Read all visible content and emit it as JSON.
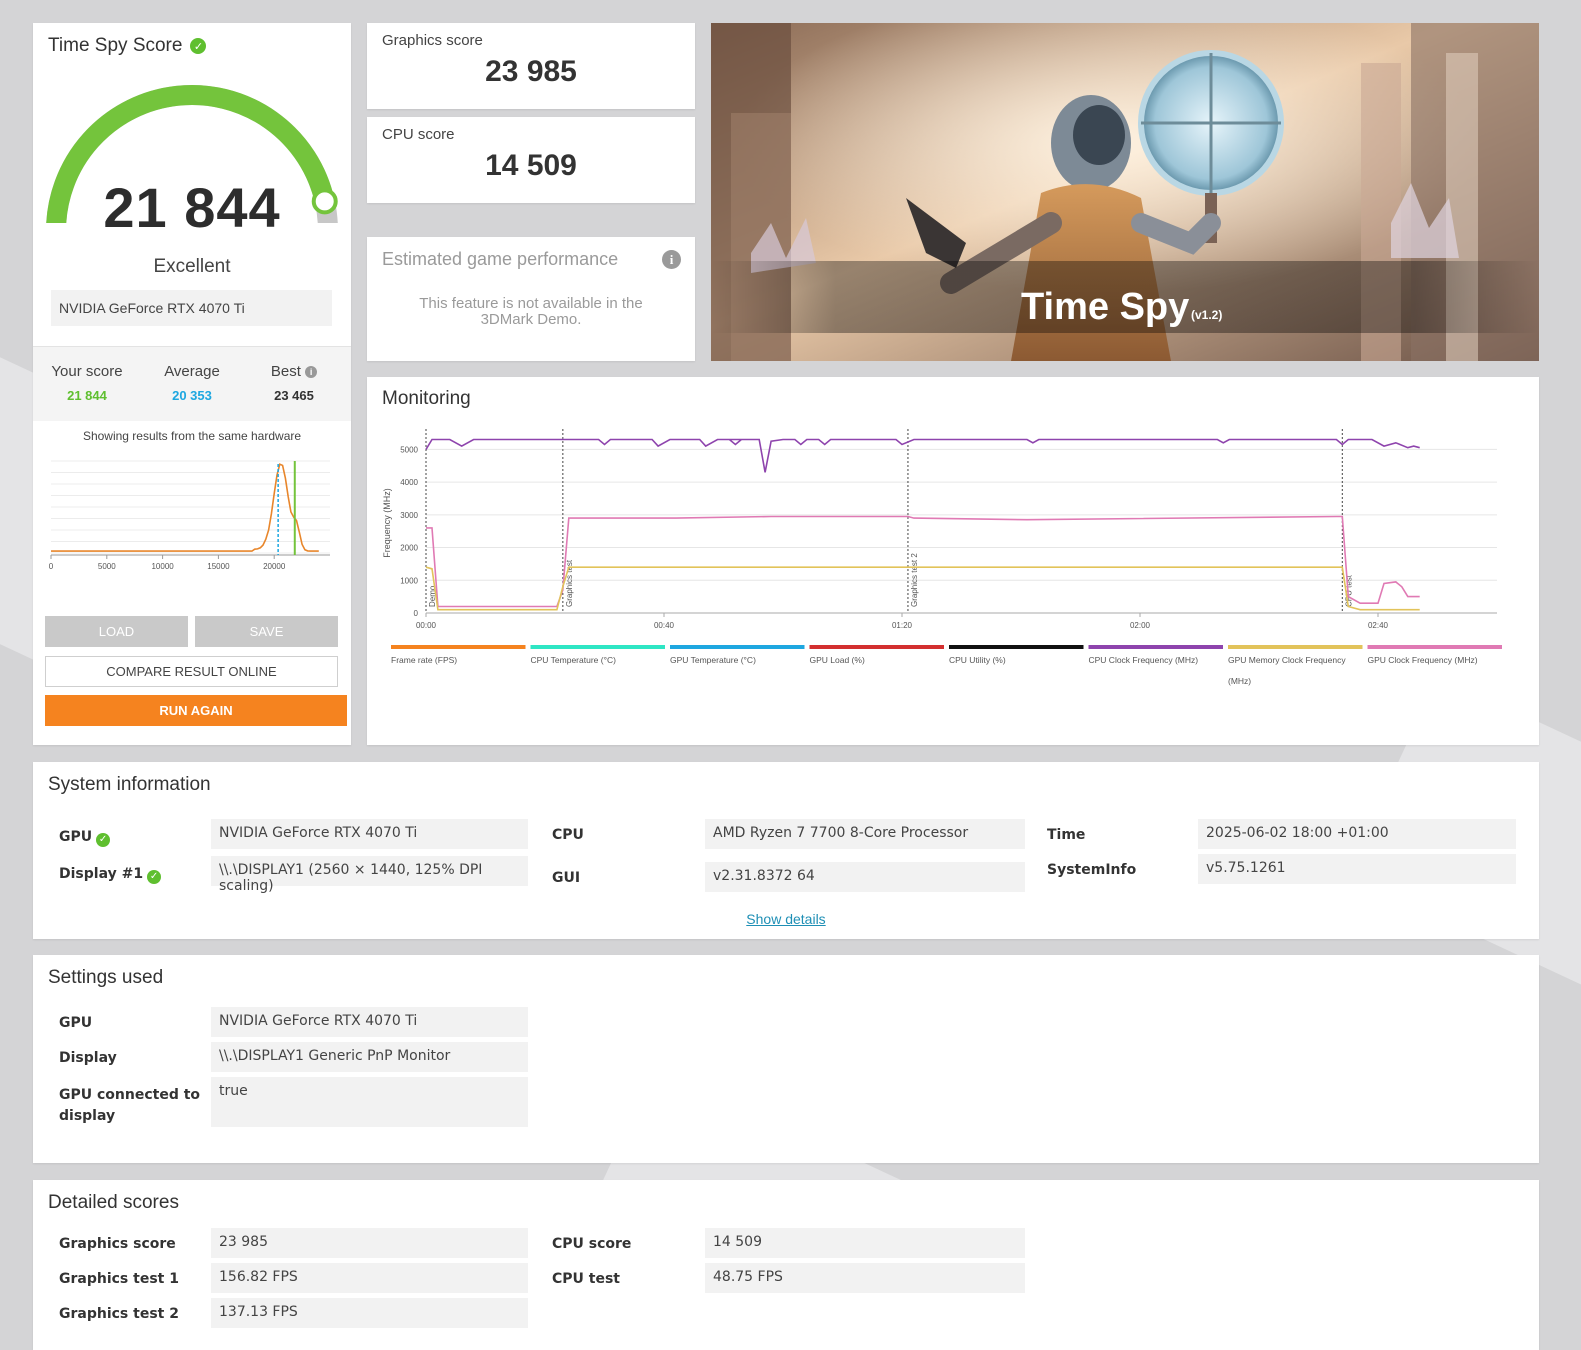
{
  "score_card": {
    "title": "Time Spy Score",
    "score": "21 844",
    "rating": "Excellent",
    "gpu": "NVIDIA GeForce RTX 4070 Ti",
    "gauge_fraction": 0.93,
    "your_score_label": "Your score",
    "your_score": "21 844",
    "average_label": "Average",
    "average": "20 353",
    "best_label": "Best",
    "best": "23 465",
    "same_hardware_text": "Showing results from the same hardware",
    "histogram": {
      "x_ticks": [
        "0",
        "5000",
        "10000",
        "15000",
        "20000"
      ],
      "xlim": [
        0,
        25000
      ],
      "your_score_value": 21844,
      "average_value": 20353
    },
    "load_label": "LOAD",
    "save_label": "SAVE",
    "compare_label": "COMPARE RESULT ONLINE",
    "run_again_label": "RUN AGAIN"
  },
  "graphics": {
    "title": "Graphics score",
    "value": "23 985"
  },
  "cpu": {
    "title": "CPU score",
    "value": "14 509"
  },
  "estimated": {
    "title": "Estimated game performance",
    "text": "This feature is not available in the 3DMark Demo."
  },
  "hero": {
    "title": "Time Spy",
    "version": "(v1.2)"
  },
  "monitoring": {
    "title": "Monitoring"
  },
  "chart_data": {
    "type": "line",
    "ylabel": "Frequency (MHz)",
    "ylim": [
      0,
      5500
    ],
    "y_ticks": [
      "0",
      "1000",
      "2000",
      "3000",
      "4000",
      "5000"
    ],
    "x_ticks": [
      "00:00",
      "00:40",
      "01:20",
      "02:00",
      "02:40"
    ],
    "xlim": [
      0,
      180
    ],
    "markers": [
      {
        "t": 0,
        "label": "Demo"
      },
      {
        "t": 23,
        "label": "Graphics test"
      },
      {
        "t": 81,
        "label": "Graphics test 2"
      },
      {
        "t": 154,
        "label": "CPU test"
      }
    ],
    "series": [
      {
        "name": "CPU Clock Frequency (MHz)",
        "color": "#8e44ad",
        "points": [
          [
            0,
            5000
          ],
          [
            1,
            5300
          ],
          [
            4,
            5300
          ],
          [
            6,
            5100
          ],
          [
            8,
            5300
          ],
          [
            23,
            5300
          ],
          [
            29,
            5300
          ],
          [
            30,
            5150
          ],
          [
            31,
            5300
          ],
          [
            38,
            5300
          ],
          [
            39,
            5100
          ],
          [
            41,
            5300
          ],
          [
            46,
            5300
          ],
          [
            47,
            5100
          ],
          [
            49,
            5300
          ],
          [
            51,
            5300
          ],
          [
            52,
            5150
          ],
          [
            53,
            5300
          ],
          [
            49,
            5300
          ],
          [
            55,
            5300
          ],
          [
            50,
            5300
          ],
          [
            51,
            5300
          ],
          [
            52,
            5300
          ],
          [
            53,
            5300
          ],
          [
            56,
            5300
          ],
          [
            57,
            4300
          ],
          [
            58,
            5250
          ],
          [
            60,
            5300
          ],
          [
            62,
            5300
          ],
          [
            63,
            5150
          ],
          [
            64,
            5300
          ],
          [
            66,
            5300
          ],
          [
            67,
            5150
          ],
          [
            68,
            5300
          ],
          [
            79,
            5300
          ],
          [
            80,
            5150
          ],
          [
            82,
            5300
          ],
          [
            101,
            5300
          ],
          [
            102,
            5200
          ],
          [
            103,
            5300
          ],
          [
            133,
            5300
          ],
          [
            134,
            5200
          ],
          [
            135,
            5300
          ],
          [
            153,
            5300
          ],
          [
            154,
            5150
          ],
          [
            155,
            5300
          ],
          [
            159,
            5300
          ],
          [
            161,
            5100
          ],
          [
            163,
            5200
          ],
          [
            165,
            5050
          ],
          [
            166,
            5100
          ],
          [
            167,
            5050
          ]
        ]
      },
      {
        "name": "GPU Clock Frequency (MHz)",
        "color": "#e07ab4",
        "points": [
          [
            0,
            2600
          ],
          [
            1,
            2600
          ],
          [
            2,
            200
          ],
          [
            6,
            200
          ],
          [
            22,
            200
          ],
          [
            23,
            700
          ],
          [
            24,
            2900
          ],
          [
            42,
            2900
          ],
          [
            58,
            2950
          ],
          [
            81,
            2950
          ],
          [
            82,
            2900
          ],
          [
            101,
            2850
          ],
          [
            153,
            2950
          ],
          [
            154,
            2950
          ],
          [
            155,
            500
          ],
          [
            157,
            300
          ],
          [
            160,
            300
          ],
          [
            161,
            900
          ],
          [
            163,
            950
          ],
          [
            164,
            800
          ],
          [
            165,
            500
          ],
          [
            167,
            500
          ]
        ]
      },
      {
        "name": "GPU Memory Clock Frequency (MHz)",
        "color": "#e2c35a",
        "points": [
          [
            0,
            1400
          ],
          [
            1,
            1350
          ],
          [
            2,
            100
          ],
          [
            6,
            100
          ],
          [
            22,
            100
          ],
          [
            23,
            800
          ],
          [
            24,
            1400
          ],
          [
            154,
            1400
          ],
          [
            155,
            200
          ],
          [
            157,
            100
          ],
          [
            167,
            100
          ]
        ]
      }
    ],
    "legend": [
      {
        "label": "Frame rate (FPS)",
        "color": "#f5831f"
      },
      {
        "label": "CPU Temperature (°C)",
        "color": "#2ee6c4"
      },
      {
        "label": "GPU Temperature (°C)",
        "color": "#1ea7e0"
      },
      {
        "label": "GPU Load (%)",
        "color": "#d32f2f"
      },
      {
        "label": "CPU Utility (%)",
        "color": "#111111"
      },
      {
        "label": "CPU Clock Frequency (MHz)",
        "color": "#8e44ad"
      },
      {
        "label": "GPU Memory Clock Frequency",
        "label2": "(MHz)",
        "color": "#e2c35a"
      },
      {
        "label": "GPU Clock Frequency (MHz)",
        "color": "#e07ab4"
      }
    ]
  },
  "system_info": {
    "title": "System information",
    "gpu_label": "GPU",
    "gpu_value": "NVIDIA GeForce RTX 4070 Ti",
    "display_label": "Display #1",
    "display_value": "\\\\.\\DISPLAY1 (2560 × 1440, 125% DPI scaling)",
    "cpu_label": "CPU",
    "cpu_value": "AMD Ryzen 7 7700 8-Core Processor",
    "gui_label": "GUI",
    "gui_value": "v2.31.8372 64",
    "time_label": "Time",
    "time_value": "2025-06-02 18:00 +01:00",
    "sysinfo_label": "SystemInfo",
    "sysinfo_value": "v5.75.1261",
    "show_details": "Show details"
  },
  "settings": {
    "title": "Settings used",
    "gpu_label": "GPU",
    "gpu_value": "NVIDIA GeForce RTX 4070 Ti",
    "display_label": "Display",
    "display_value": "\\\\.\\DISPLAY1 Generic PnP Monitor",
    "connected_label_1": "GPU connected to",
    "connected_label_2": "display",
    "connected_value": "true"
  },
  "detailed": {
    "title": "Detailed scores",
    "graphics_label": "Graphics score",
    "graphics_value": "23 985",
    "gt1_label": "Graphics test 1",
    "gt1_value": "156.82 FPS",
    "gt2_label": "Graphics test 2",
    "gt2_value": "137.13 FPS",
    "cpu_label": "CPU score",
    "cpu_value": "14 509",
    "cpu_test_label": "CPU test",
    "cpu_test_value": "48.75 FPS"
  },
  "colors": {
    "accent_orange": "#f5831f",
    "good_green": "#5fbf2f",
    "average_blue": "#1ea7e0",
    "link_blue": "#1e8fb5"
  }
}
